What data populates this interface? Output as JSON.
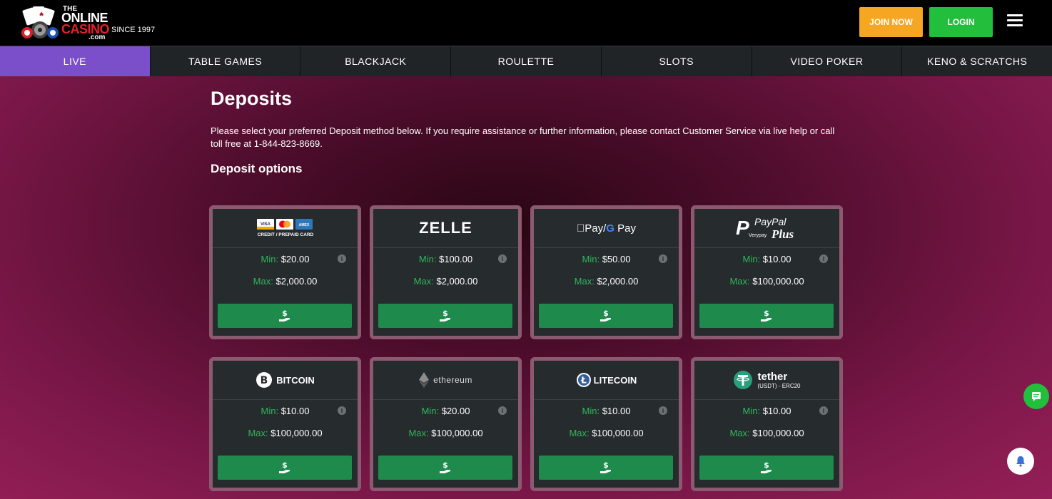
{
  "header": {
    "logo": {
      "the": "THE",
      "online": "ONLINE",
      "casino": "CASINO",
      "since": "SINCE 1997",
      "com": ".com"
    },
    "join_label": "JOIN NOW",
    "login_label": "LOGIN",
    "menu_icon": "hamburger-icon"
  },
  "nav": {
    "items": [
      {
        "label": "LIVE",
        "active": true
      },
      {
        "label": "TABLE GAMES"
      },
      {
        "label": "BLACKJACK"
      },
      {
        "label": "ROULETTE"
      },
      {
        "label": "SLOTS"
      },
      {
        "label": "VIDEO POKER"
      },
      {
        "label": "KENO & SCRATCHS"
      }
    ]
  },
  "page": {
    "title": "Deposits",
    "description": "Please select your preferred Deposit method below. If you require assistance or further information, please contact Customer Service via live help or call toll free at 1-844-823-8669.",
    "subtitle": "Deposit options"
  },
  "methods": [
    {
      "name": "CREDIT / PREPAID CARD",
      "logo_text": {
        "visa": "VISA",
        "amex": "AMEX"
      },
      "min_label": "Min:",
      "min": "$20.00",
      "max_label": "Max:",
      "max": "$2,000.00"
    },
    {
      "name": "ZELLE",
      "min_label": "Min:",
      "min": "$100.00",
      "max_label": "Max:",
      "max": "$2,000.00"
    },
    {
      "name": "Pay / G Pay",
      "logo_text": {
        "apple": "Pay",
        "g": "G",
        "gpay": "Pay"
      },
      "min_label": "Min:",
      "min": "$50.00",
      "max_label": "Max:",
      "max": "$2,000.00"
    },
    {
      "name": "PayPal Plus",
      "logo_text": {
        "paypal": "PayPal",
        "verypay": "Verypay",
        "plus": "Plus"
      },
      "min_label": "Min:",
      "min": "$10.00",
      "max_label": "Max:",
      "max": "$100,000.00"
    },
    {
      "name": "BITCOIN",
      "min_label": "Min:",
      "min": "$10.00",
      "max_label": "Max:",
      "max": "$100,000.00"
    },
    {
      "name": "ethereum",
      "min_label": "Min:",
      "min": "$20.00",
      "max_label": "Max:",
      "max": "$100,000.00"
    },
    {
      "name": "LITECOIN",
      "min_label": "Min:",
      "min": "$10.00",
      "max_label": "Max:",
      "max": "$100,000.00"
    },
    {
      "name": "tether",
      "logo_text": {
        "sub": "(USDT) - ERC20"
      },
      "min_label": "Min:",
      "min": "$10.00",
      "max_label": "Max:",
      "max": "$100,000.00"
    }
  ],
  "info_glyph": "i",
  "colors": {
    "accent_green": "#2fb75a",
    "button_green": "#1e8a4c",
    "nav_active": "#7b4fc9",
    "join": "#f5a623",
    "login": "#22bf3c"
  },
  "fabs": {
    "chat_icon": "chat-icon",
    "bell_icon": "bell-icon"
  }
}
